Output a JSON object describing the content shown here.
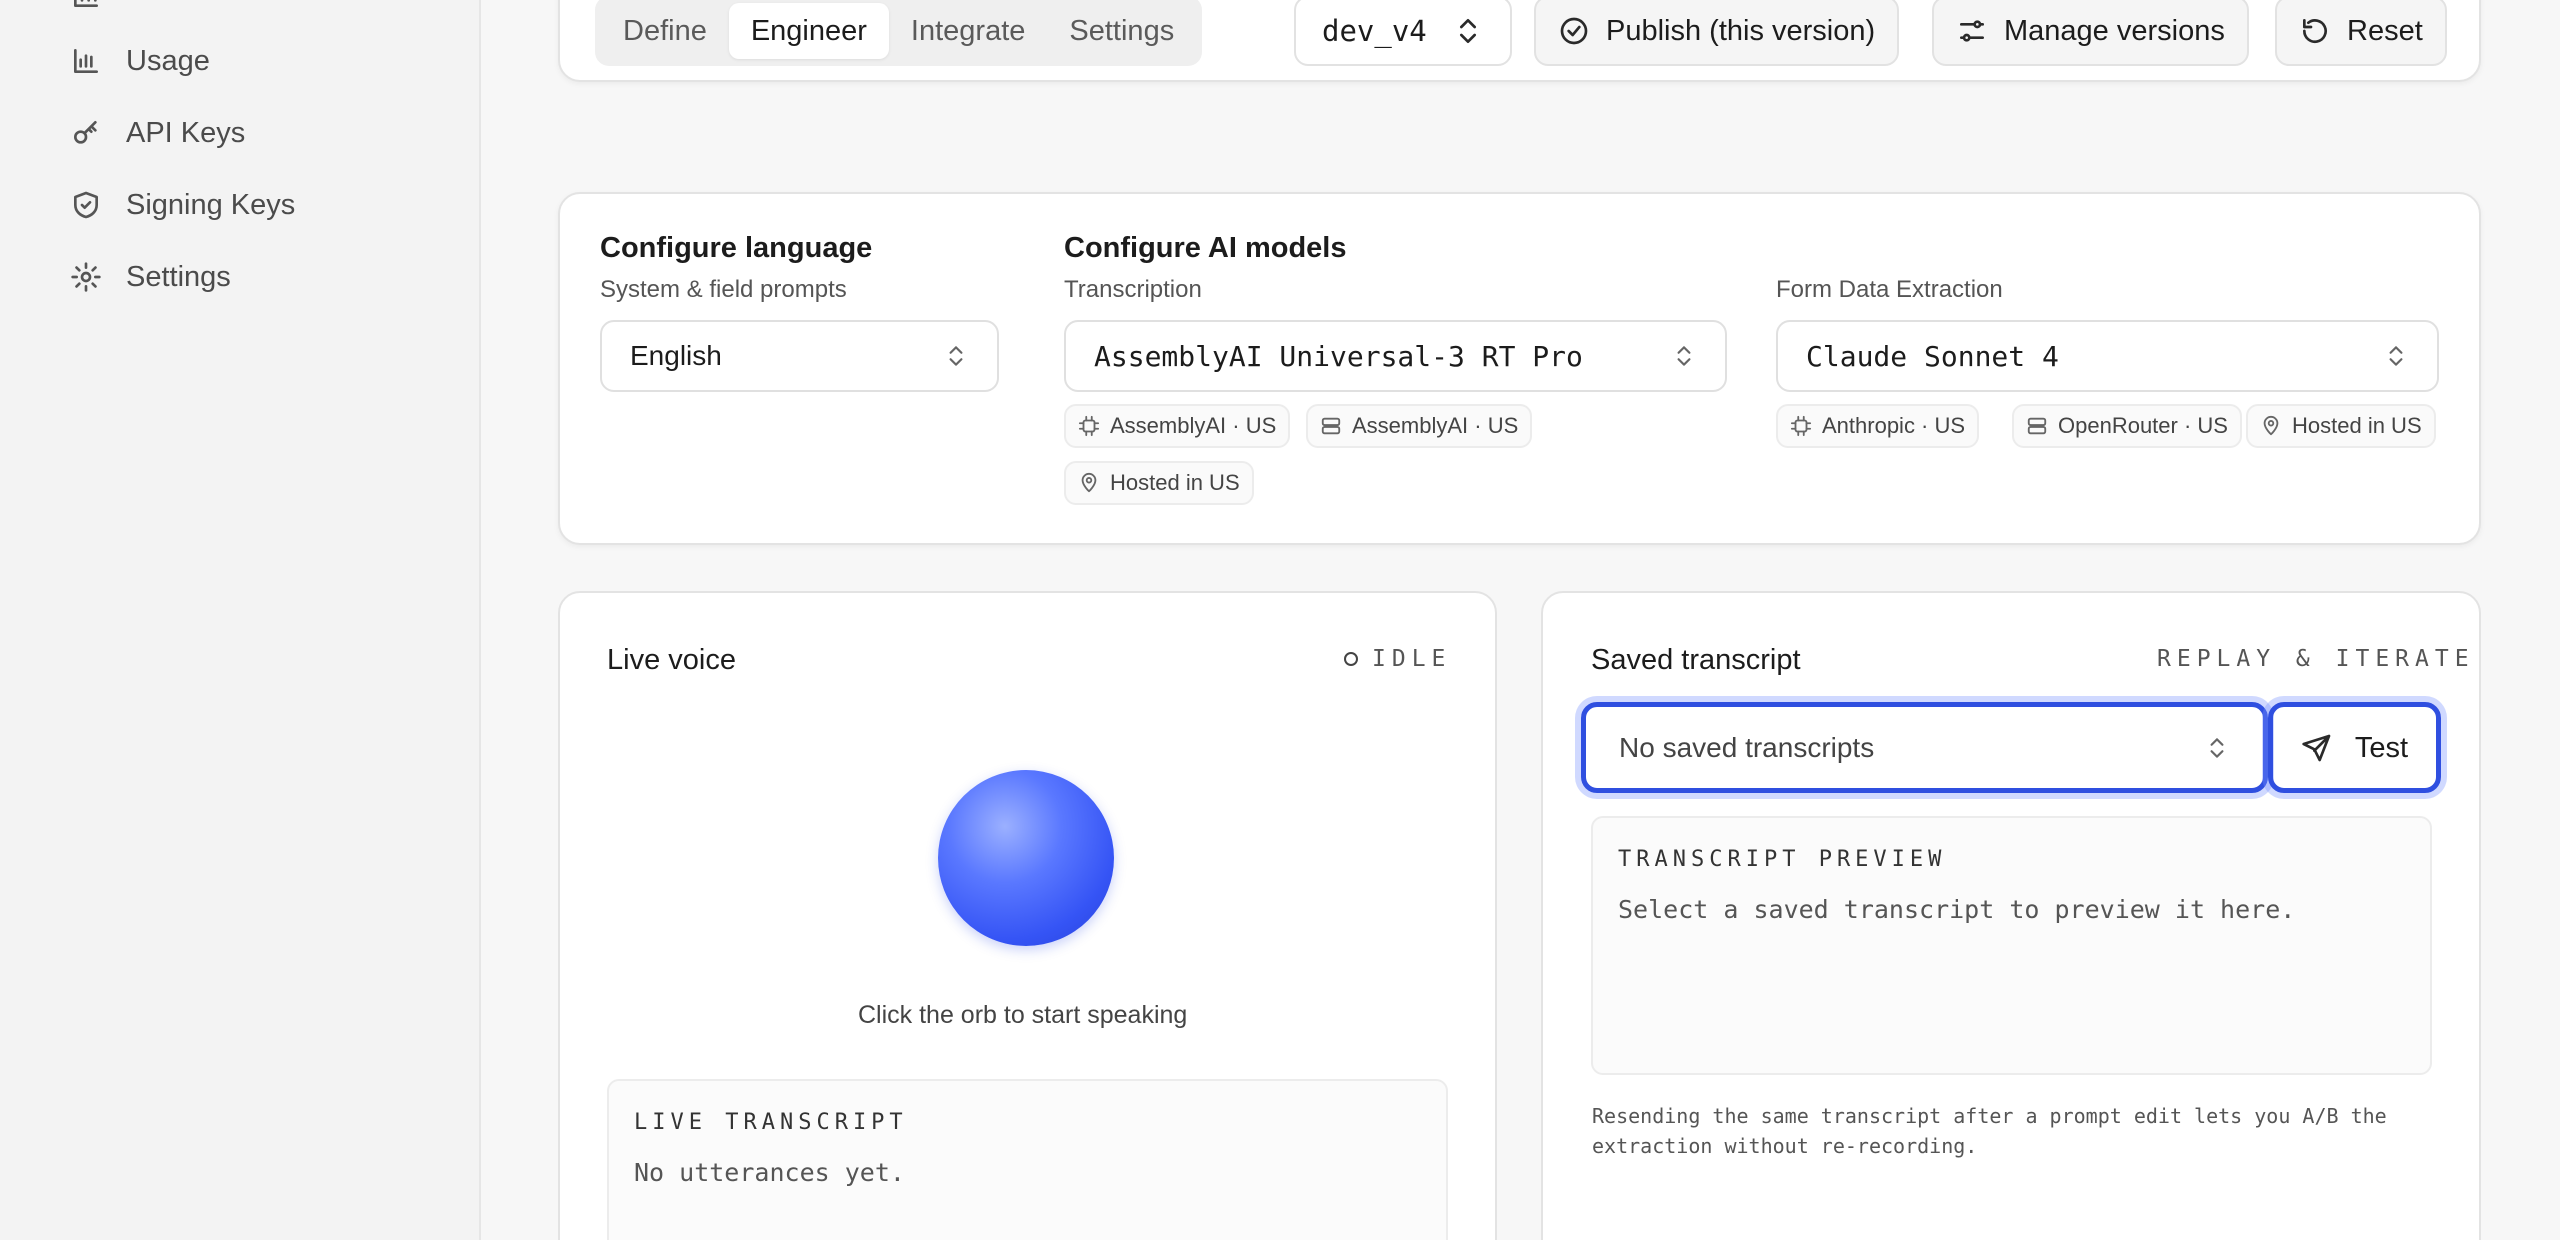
{
  "sidebar": {
    "items": [
      {
        "label": "Usage",
        "icon": "bar-chart-icon"
      },
      {
        "label": "API Keys",
        "icon": "key-icon"
      },
      {
        "label": "Signing Keys",
        "icon": "shield-icon"
      },
      {
        "label": "Settings",
        "icon": "gear-icon"
      }
    ]
  },
  "toolbar": {
    "tabs": [
      "Define",
      "Engineer",
      "Integrate",
      "Settings"
    ],
    "active_tab": "Engineer",
    "version": "dev_v4",
    "publish_label": "Publish (this version)",
    "manage_label": "Manage versions",
    "reset_label": "Reset"
  },
  "config": {
    "language": {
      "title": "Configure language",
      "subtitle": "System & field prompts",
      "value": "English"
    },
    "models": {
      "title": "Configure AI models",
      "transcription": {
        "label": "Transcription",
        "value": "AssemblyAI Universal-3 RT Pro",
        "chips": [
          "AssemblyAI · US",
          "AssemblyAI · US",
          "Hosted in US"
        ]
      },
      "extraction": {
        "label": "Form Data Extraction",
        "value": "Claude Sonnet 4",
        "chips": [
          "Anthropic · US",
          "OpenRouter · US",
          "Hosted in US"
        ]
      }
    }
  },
  "live": {
    "title": "Live voice",
    "status": "IDLE",
    "caption": "Click the orb to start speaking",
    "transcript_label": "LIVE TRANSCRIPT",
    "transcript_text": "No utterances yet."
  },
  "saved": {
    "title": "Saved transcript",
    "tag": "REPLAY & ITERATE",
    "select_value": "No saved transcripts",
    "test_label": "Test",
    "preview_label": "TRANSCRIPT PREVIEW",
    "preview_text": "Select a saved transcript to preview it here.",
    "note": "Resending the same transcript after a prompt edit lets you A/B the extraction without re-recording."
  },
  "colors": {
    "accent": "#2f4fe0",
    "orb": "#3554f5"
  }
}
